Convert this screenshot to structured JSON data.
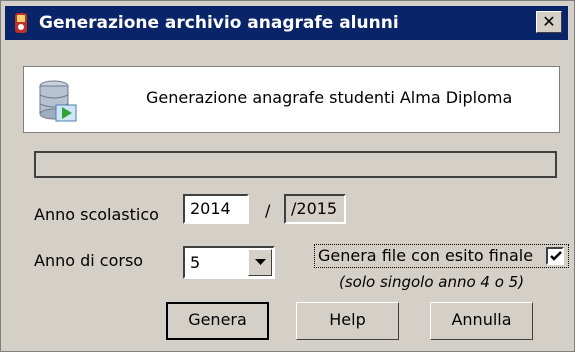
{
  "window": {
    "title": "Generazione archivio anagrafe alunni",
    "close_label": "✕"
  },
  "header": {
    "text": "Generazione anagrafe studenti Alma Diploma",
    "icon": "database-export-icon"
  },
  "progress": {
    "value": 0
  },
  "form": {
    "anno_scolastico_label": "Anno scolastico",
    "anno_scolastico_value": "2014",
    "separator": "/",
    "anno_scolastico_end": "/2015",
    "anno_di_corso_label": "Anno di corso",
    "anno_di_corso_value": "5",
    "genera_file_label": "Genera file con esito finale",
    "genera_file_checked": true,
    "note": "(solo singolo anno 4 o 5)"
  },
  "buttons": {
    "genera": "Genera",
    "help": "Help",
    "annulla": "Annulla"
  },
  "colors": {
    "titlebar": "#0a246a",
    "face": "#d4d0c8"
  }
}
